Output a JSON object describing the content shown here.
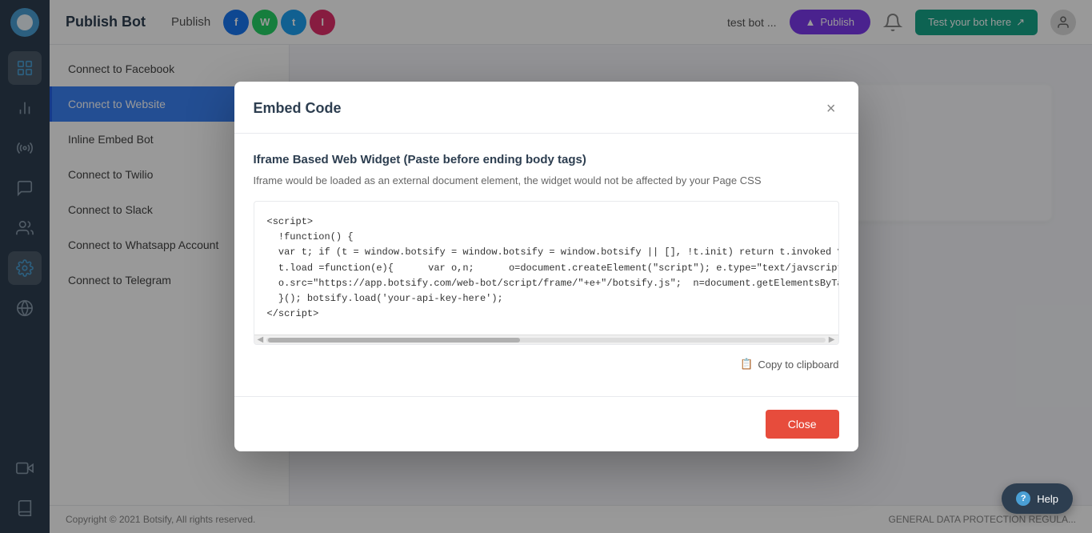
{
  "app": {
    "title": "Publish Bot"
  },
  "header": {
    "title": "Publish Bot",
    "publish_label": "Publish",
    "bot_name": "test bot ...",
    "publish_button": "Publish",
    "test_bot_button": "Test your bot here",
    "icons": [
      {
        "color": "#3b82f6",
        "letter": "F"
      },
      {
        "color": "#22c55e",
        "letter": "W"
      },
      {
        "color": "#06b6d4",
        "letter": "T"
      },
      {
        "color": "#f59e0b",
        "letter": "I"
      }
    ]
  },
  "sidebar": {
    "items": [
      {
        "name": "dashboard",
        "icon": "grid"
      },
      {
        "name": "analytics",
        "icon": "bar-chart"
      },
      {
        "name": "broadcast",
        "icon": "radio"
      },
      {
        "name": "conversations",
        "icon": "message-square"
      },
      {
        "name": "users",
        "icon": "users"
      },
      {
        "name": "settings",
        "icon": "settings"
      },
      {
        "name": "globe",
        "icon": "globe"
      },
      {
        "name": "video",
        "icon": "video"
      },
      {
        "name": "book",
        "icon": "book"
      }
    ]
  },
  "left_nav": {
    "items": [
      {
        "label": "Connect to Facebook",
        "active": false
      },
      {
        "label": "Connect to Website",
        "active": true
      },
      {
        "label": "Inline Embed Bot",
        "active": false
      },
      {
        "label": "Connect to Twilio",
        "active": false
      },
      {
        "label": "Connect to Slack",
        "active": false
      },
      {
        "label": "Connect to Whatsapp Account",
        "active": false
      },
      {
        "label": "Connect to Telegram",
        "active": false
      }
    ]
  },
  "modal": {
    "title": "Embed Code",
    "section_title": "Iframe Based Web Widget (Paste before ending body tags)",
    "description": "Iframe would be loaded as an external document element, the widget would not be affected by your Page CSS",
    "code": "<script>\n  !function() {\n  var t; if (t = window.botsify = window.botsify = window.botsify || [], !t.init) return t.invoked ? void (wind\n  t.load =function(e){      var o,n;      o=document.createElement(\"script\"); e.type=\"text/javscript\"; o.asy\n  o.src=\"https://app.botsify.com/web-bot/script/frame/\"+e+\"/botsify.js\";  n=document.getElementsByTagName(\"scri\n  }(); botsify.load('your-api-key-here');\n<\\/script>",
    "copy_button": "Copy to clipboard",
    "close_button": "Close"
  },
  "footer": {
    "copyright": "Copyright © 2021 Botsify, All rights reserved.",
    "gdpr": "GENERAL DATA PROTECTION REGULA..."
  }
}
